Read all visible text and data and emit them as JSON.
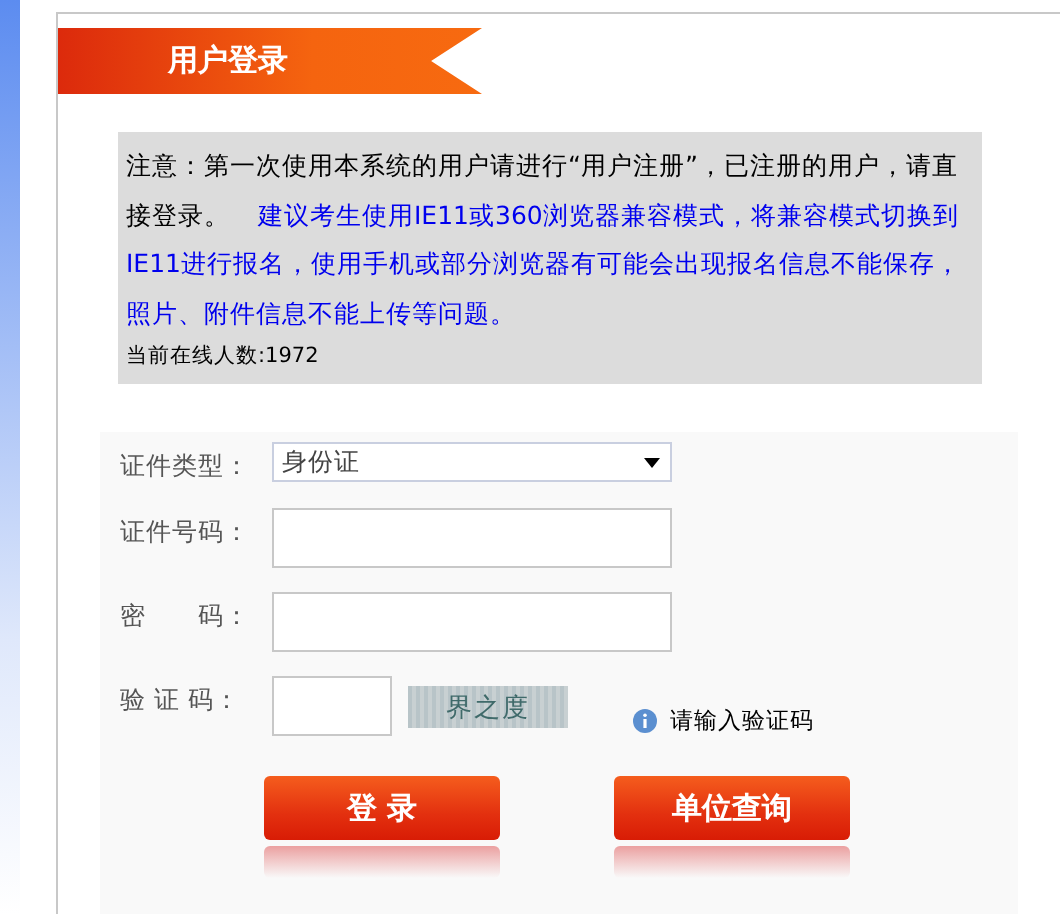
{
  "header": {
    "title": "用户登录"
  },
  "notice": {
    "text": "注意：第一次使用本系统的用户请进行“用户注册”，已注册的用户，请直接登录。",
    "advice": "建议考生使用IE11或360浏览器兼容模式，将兼容模式切换到IE11进行报名，使用手机或部分浏览器有可能会出现报名信息不能保存，照片、附件信息不能上传等问题。",
    "online": "当前在线人数:1972"
  },
  "form": {
    "fields": [
      {
        "kind": "select",
        "label": "证件类型：",
        "value": "身份证"
      },
      {
        "kind": "text",
        "label": "证件号码："
      },
      {
        "kind": "password",
        "label": "密　　码："
      },
      {
        "kind": "captcha",
        "label": "验 证 码：",
        "captcha_text": "界之度",
        "hint": "请输入验证码"
      }
    ],
    "buttons": [
      "登 录",
      "单位查询"
    ]
  }
}
